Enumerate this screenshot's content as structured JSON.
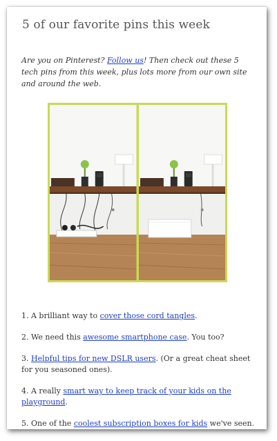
{
  "post": {
    "title": "5 of our favorite pins this week",
    "intro": {
      "pre": "Are you on Pinterest? ",
      "link": "Follow us",
      "post": "! Then check out these 5 tech pins from this week, plus lots more from our own site and around the web."
    },
    "items": [
      {
        "pre": "1. A brilliant way to ",
        "link": "cover those cord tangles",
        "post": "."
      },
      {
        "pre": "2. We need this ",
        "link": "awesome smartphone case",
        "post": ". You too?"
      },
      {
        "pre": "3. ",
        "link": "Helpful tips for new DSLR users",
        "post": ". (Or a great cheat sheet for you seasoned ones)."
      },
      {
        "pre": "4. A really ",
        "link": "smart way to keep track of your kids on the playground",
        "post": "."
      },
      {
        "pre": "5. One of the ",
        "link": "coolest subscription boxes for kids",
        "post": " we've seen."
      }
    ]
  },
  "colors": {
    "photo_frame": "#c9d952",
    "link": "#1f3fbf"
  }
}
